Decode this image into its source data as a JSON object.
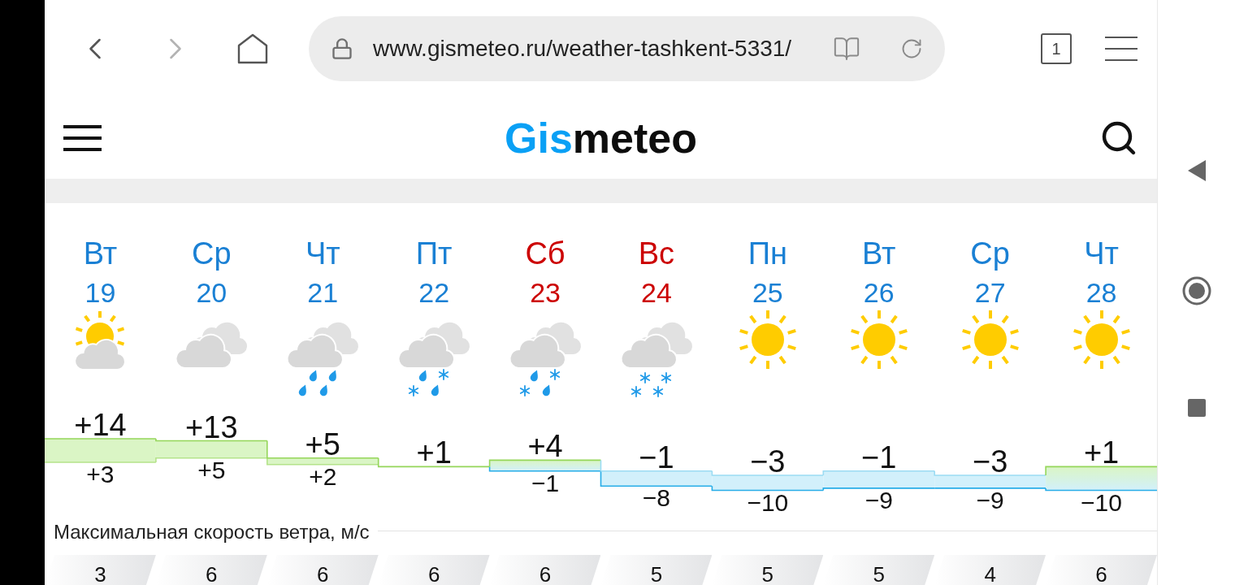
{
  "browser": {
    "nav_buttons": [
      {
        "kind": "back",
        "disabled": false
      },
      {
        "kind": "forward",
        "disabled": true
      }
    ],
    "address": "www.gismeteo.ru/weather-tashkent-5331/",
    "tab_count": "1"
  },
  "site_header": {
    "logo_prefix": "Gis",
    "logo_suffix": "meteo"
  },
  "days": [
    {
      "weekday": "Вт",
      "date": "19",
      "weekend": false,
      "kind": "partly",
      "high": "+14",
      "low": "+3"
    },
    {
      "weekday": "Ср",
      "date": "20",
      "weekend": false,
      "kind": "overcast",
      "high": "+13",
      "low": "+5"
    },
    {
      "weekday": "Чт",
      "date": "21",
      "weekend": false,
      "kind": "rain",
      "high": "+5",
      "low": "+2"
    },
    {
      "weekday": "Пт",
      "date": "22",
      "weekend": false,
      "kind": "sleet",
      "high": "+1"
    },
    {
      "weekday": "Сб",
      "date": "23",
      "weekend": true,
      "kind": "sleet",
      "high": "+4",
      "low": "−1"
    },
    {
      "weekday": "Вс",
      "date": "24",
      "weekend": true,
      "kind": "snow",
      "high": "−1",
      "low": "−8"
    },
    {
      "weekday": "Пн",
      "date": "25",
      "weekend": false,
      "kind": "clear",
      "high": "−3",
      "low": "−10"
    },
    {
      "weekday": "Вт",
      "date": "26",
      "weekend": false,
      "kind": "clear",
      "high": "−1",
      "low": "−9"
    },
    {
      "weekday": "Ср",
      "date": "27",
      "weekend": false,
      "kind": "clear",
      "high": "−3",
      "low": "−9"
    },
    {
      "weekday": "Чт",
      "date": "28",
      "weekend": false,
      "kind": "clear",
      "high": "+1",
      "low": "−10"
    }
  ],
  "wind": {
    "title": "Максимальная скорость ветра, м/с",
    "values": [
      "3",
      "6",
      "6",
      "6",
      "6",
      "5",
      "5",
      "5",
      "4",
      "6"
    ]
  }
}
